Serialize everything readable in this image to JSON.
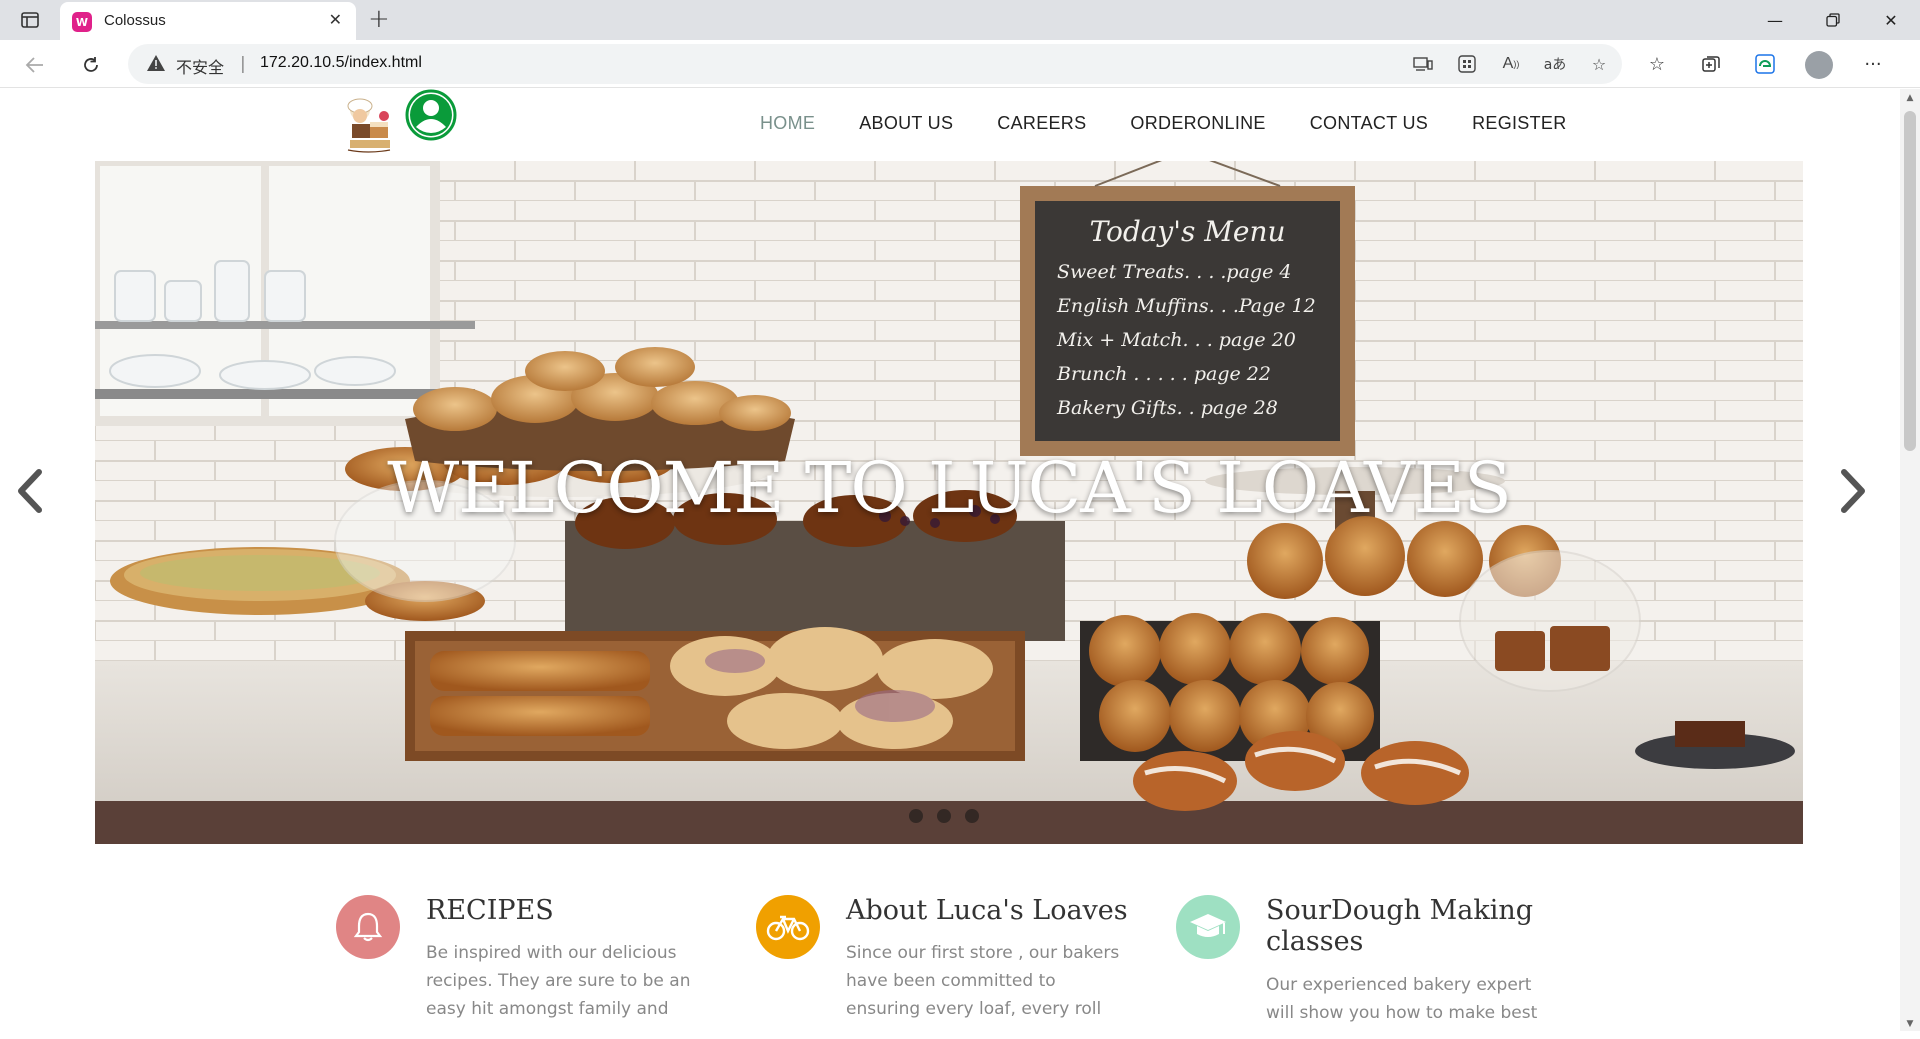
{
  "browser": {
    "tab_title": "Colossus",
    "tab_favicon_letter": "W",
    "security_label": "不安全",
    "separator": "|",
    "url": "172.20.10.5/index.html",
    "omnibox_icons": [
      "device-icon",
      "apps-icon",
      "read-aloud-icon",
      "translate-icon",
      "add-favorite-icon"
    ],
    "toolbar_icons": [
      "favorites-icon",
      "collections-icon",
      "edge-bar-icon",
      "profile-icon",
      "more-icon"
    ]
  },
  "site": {
    "nav": [
      {
        "label": "HOME",
        "active": true
      },
      {
        "label": "ABOUT US",
        "active": false
      },
      {
        "label": "CAREERS",
        "active": false
      },
      {
        "label": "ORDERONLINE",
        "active": false
      },
      {
        "label": "CONTACT US",
        "active": false
      },
      {
        "label": "REGISTER",
        "active": false
      }
    ],
    "accent_nav_active": "#79908b",
    "user_icon_color": "#0a9b3a"
  },
  "hero": {
    "title": "WELCOME TO LUCA'S LOAVES",
    "menu_board": {
      "heading": "Today's Menu",
      "lines": [
        "Sweet Treats. . . .page 4",
        "English Muffins. . .Page 12",
        "Mix + Match. . . page 20",
        "Brunch . . . . . page 22",
        "Bakery Gifts. . page 28"
      ]
    },
    "slide_count": 3
  },
  "features": [
    {
      "title": "RECIPES",
      "icon": "bell-icon",
      "color": "#e08585",
      "text_lines": [
        "Be inspired with our delicious",
        "recipes. They are sure to be an",
        "easy hit amongst family and"
      ]
    },
    {
      "title": "About Luca's Loaves",
      "icon": "bicycle-icon",
      "color": "#f0a000",
      "text_lines": [
        "Since our first store , our bakers",
        "have been committed to",
        "ensuring every loaf, every roll"
      ]
    },
    {
      "title": "SourDough Making classes",
      "icon": "graduation-cap-icon",
      "color": "#9ee0c2",
      "text_lines": [
        "Our experienced bakery expert",
        "will show you how to make best"
      ]
    }
  ]
}
